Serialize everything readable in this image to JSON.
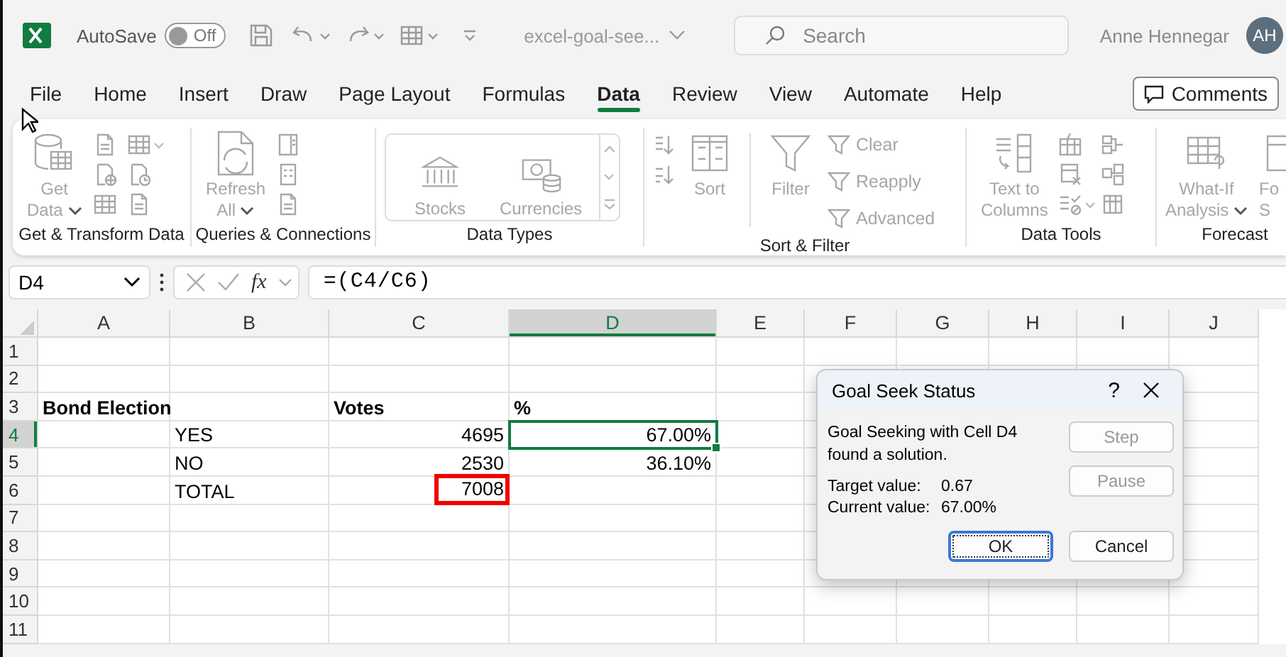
{
  "title_bar": {
    "autosave": {
      "label": "AutoSave",
      "on": false,
      "state_text": "Off"
    },
    "file_name": "excel-goal-see...",
    "search": {
      "placeholder": "Search"
    },
    "user": {
      "name": "Anne Hennegar",
      "initials": "AH"
    }
  },
  "menu": {
    "tabs": [
      {
        "label": "File",
        "selected": false
      },
      {
        "label": "Home",
        "selected": false
      },
      {
        "label": "Insert",
        "selected": false
      },
      {
        "label": "Draw",
        "selected": false
      },
      {
        "label": "Page Layout",
        "selected": false
      },
      {
        "label": "Formulas",
        "selected": false
      },
      {
        "label": "Data",
        "selected": true
      },
      {
        "label": "Review",
        "selected": false
      },
      {
        "label": "View",
        "selected": false
      },
      {
        "label": "Automate",
        "selected": false
      },
      {
        "label": "Help",
        "selected": false
      }
    ],
    "comments": "Comments"
  },
  "ribbon": {
    "groups": [
      {
        "label": "Get & Transform Data",
        "buttons": [
          {
            "kind": "large",
            "lines": [
              "Get",
              "Data"
            ],
            "dropdown": true,
            "disabled": true
          }
        ]
      },
      {
        "label": "Queries & Connections",
        "buttons": [
          {
            "kind": "large",
            "lines": [
              "Refresh",
              "All"
            ],
            "dropdown": true,
            "disabled": true
          }
        ]
      },
      {
        "label": "Data Types",
        "buttons": [
          {
            "kind": "tile",
            "lines": [
              "Stocks"
            ],
            "dropdown": false,
            "disabled": true
          },
          {
            "kind": "tile",
            "lines": [
              "Currencies"
            ],
            "dropdown": false,
            "disabled": true
          }
        ]
      },
      {
        "label": "Sort & Filter",
        "buttons": [
          {
            "kind": "large",
            "lines": [
              "Sort"
            ],
            "dropdown": false,
            "disabled": true
          },
          {
            "kind": "large",
            "lines": [
              "Filter"
            ],
            "dropdown": false,
            "disabled": true
          },
          {
            "kind": "small",
            "lines": [
              "Clear"
            ],
            "dropdown": false,
            "disabled": true
          },
          {
            "kind": "small",
            "lines": [
              "Reapply"
            ],
            "dropdown": false,
            "disabled": true
          },
          {
            "kind": "small",
            "lines": [
              "Advanced"
            ],
            "dropdown": false,
            "disabled": true
          }
        ]
      },
      {
        "label": "Data Tools",
        "buttons": [
          {
            "kind": "large",
            "lines": [
              "Text to",
              "Columns"
            ],
            "dropdown": false,
            "disabled": true
          }
        ]
      },
      {
        "label": "Forecast",
        "buttons": [
          {
            "kind": "large",
            "lines": [
              "What-If",
              "Analysis"
            ],
            "dropdown": true,
            "disabled": true
          },
          {
            "kind": "large",
            "lines": [
              "Fo",
              "S"
            ],
            "dropdown": false,
            "disabled": true
          }
        ]
      }
    ]
  },
  "formula_bar": {
    "name_box": "D4",
    "function_label": "fx",
    "formula": "=(C4/C6)"
  },
  "sheet": {
    "columns": [
      {
        "label": "A",
        "selected": false
      },
      {
        "label": "B",
        "selected": false
      },
      {
        "label": "C",
        "selected": false
      },
      {
        "label": "D",
        "selected": true
      },
      {
        "label": "E",
        "selected": false
      },
      {
        "label": "F",
        "selected": false
      },
      {
        "label": "G",
        "selected": false
      },
      {
        "label": "H",
        "selected": false
      },
      {
        "label": "I",
        "selected": false
      },
      {
        "label": "J",
        "selected": false
      }
    ],
    "rows": [
      {
        "label": "1",
        "selected": false,
        "cells": []
      },
      {
        "label": "2",
        "selected": false,
        "cells": []
      },
      {
        "label": "3",
        "selected": false,
        "cells": [
          {
            "kind": "text",
            "text": "Bond Election",
            "bold": true,
            "selected": false,
            "outlined": false
          },
          {
            "kind": "blank"
          },
          {
            "kind": "text",
            "text": "Votes",
            "bold": true,
            "selected": false,
            "outlined": false
          },
          {
            "kind": "text",
            "text": "%",
            "bold": true,
            "selected": false,
            "outlined": false
          }
        ]
      },
      {
        "label": "4",
        "selected": true,
        "cells": [
          {
            "kind": "blank"
          },
          {
            "kind": "text",
            "text": "YES",
            "bold": false,
            "selected": false,
            "outlined": false
          },
          {
            "kind": "number",
            "text": "4695",
            "bold": false,
            "selected": false,
            "outlined": false
          },
          {
            "kind": "number",
            "text": "67.00%",
            "bold": false,
            "selected": true,
            "outlined": false
          }
        ]
      },
      {
        "label": "5",
        "selected": false,
        "cells": [
          {
            "kind": "blank"
          },
          {
            "kind": "text",
            "text": "NO",
            "bold": false,
            "selected": false,
            "outlined": false
          },
          {
            "kind": "number",
            "text": "2530",
            "bold": false,
            "selected": false,
            "outlined": false
          },
          {
            "kind": "number",
            "text": "36.10%",
            "bold": false,
            "selected": false,
            "outlined": false
          }
        ]
      },
      {
        "label": "6",
        "selected": false,
        "cells": [
          {
            "kind": "blank"
          },
          {
            "kind": "text",
            "text": "TOTAL",
            "bold": false,
            "selected": false,
            "outlined": false
          },
          {
            "kind": "number",
            "text": "7008",
            "bold": false,
            "selected": false,
            "outlined": true
          }
        ]
      },
      {
        "label": "7",
        "selected": false,
        "cells": []
      },
      {
        "label": "8",
        "selected": false,
        "cells": []
      },
      {
        "label": "9",
        "selected": false,
        "cells": []
      },
      {
        "label": "10",
        "selected": false,
        "cells": []
      },
      {
        "label": "11",
        "selected": false,
        "cells": []
      }
    ]
  },
  "dialog": {
    "title": "Goal Seek Status",
    "help": "?",
    "message": "Goal Seeking with Cell D4 found a solution.",
    "values": [
      {
        "label": "Target value:",
        "value": "0.67"
      },
      {
        "label": "Current value:",
        "value": "67.00%"
      }
    ],
    "side_buttons": [
      {
        "label": "Step",
        "disabled": true,
        "default": false
      },
      {
        "label": "Pause",
        "disabled": true,
        "default": false
      }
    ],
    "footer_buttons": [
      {
        "label": "OK",
        "disabled": false,
        "default": true
      },
      {
        "label": "Cancel",
        "disabled": false,
        "default": false
      }
    ]
  }
}
